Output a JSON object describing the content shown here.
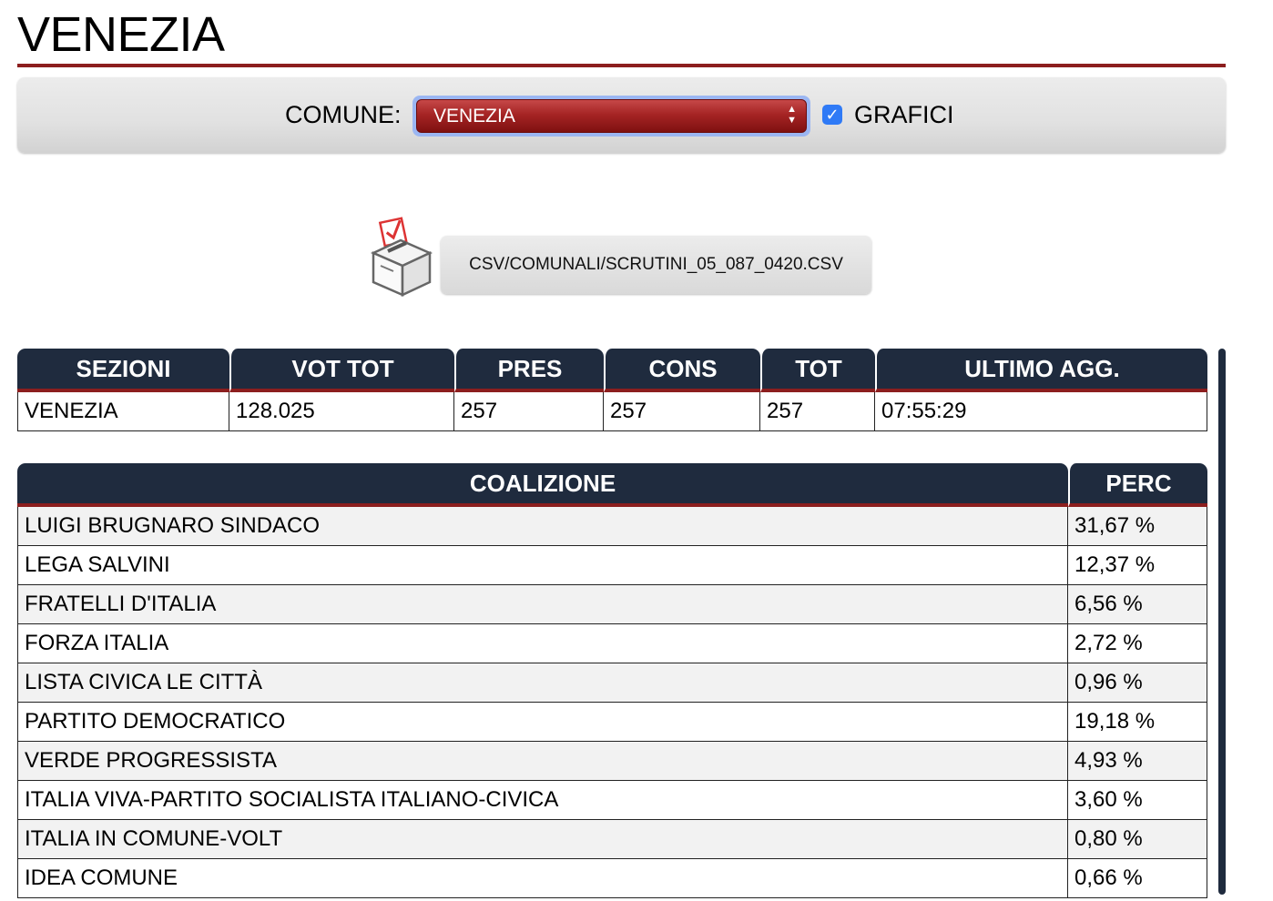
{
  "page_title": "VENEZIA",
  "toolbar": {
    "comune_label": "COMUNE:",
    "comune_selected": "VENEZIA",
    "grafici_label": "GRAFICI",
    "grafici_checked": true
  },
  "file_button": {
    "label": "CSV/COMUNALI/SCRUTINI_05_087_0420.CSV"
  },
  "sezioni_table": {
    "headers": [
      "SEZIONI",
      "VOT TOT",
      "PRES",
      "CONS",
      "TOT",
      "ULTIMO AGG."
    ],
    "row": [
      "VENEZIA",
      "128.025",
      "257",
      "257",
      "257",
      "07:55:29"
    ]
  },
  "coalizione_table": {
    "headers": [
      "COALIZIONE",
      "PERC"
    ],
    "rows": [
      [
        "LUIGI BRUGNARO SINDACO",
        "31,67 %"
      ],
      [
        "LEGA SALVINI",
        "12,37 %"
      ],
      [
        "FRATELLI D'ITALIA",
        "6,56 %"
      ],
      [
        "FORZA ITALIA",
        "2,72 %"
      ],
      [
        "LISTA CIVICA LE CITTÀ",
        "0,96 %"
      ],
      [
        "PARTITO DEMOCRATICO",
        "19,18 %"
      ],
      [
        "VERDE PROGRESSISTA",
        "4,93 %"
      ],
      [
        "ITALIA VIVA-PARTITO SOCIALISTA ITALIANO-CIVICA",
        "3,60 %"
      ],
      [
        "ITALIA IN COMUNE-VOLT",
        "0,80 %"
      ],
      [
        "IDEA COMUNE",
        "0,66 %"
      ]
    ]
  },
  "colors": {
    "accent": "#8c1e1e",
    "header_bg": "#1f2b3e",
    "checkbox": "#2f7af6"
  },
  "icons": {
    "ballot": "ballot-box-icon",
    "select_arrows": "select-arrows-icon",
    "checkbox": "checkmark-icon"
  }
}
